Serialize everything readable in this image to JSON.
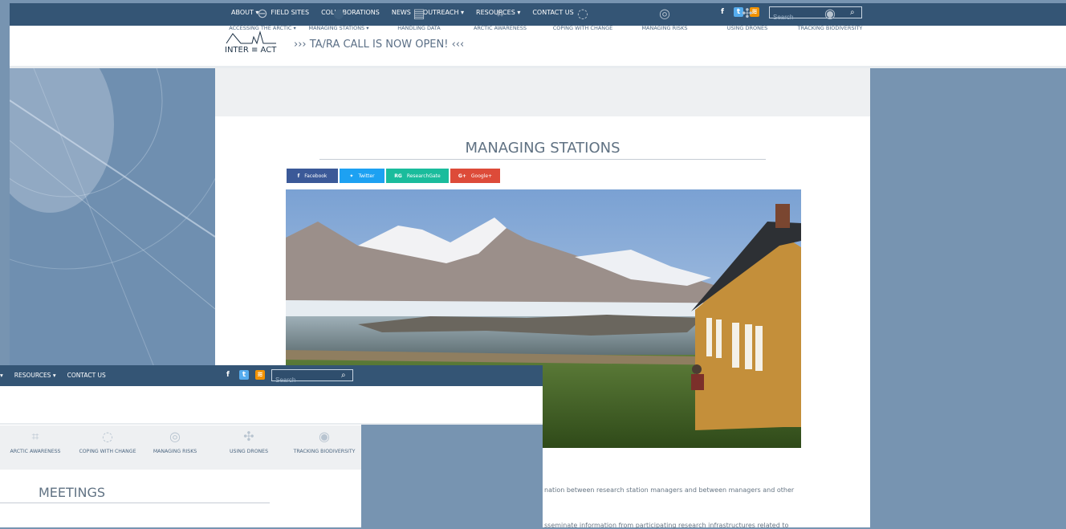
{
  "nav": {
    "items": [
      "ABOUT ▾",
      "FIELD SITES",
      "COLLABORATIONS",
      "NEWS",
      "OUTREACH ▾",
      "RESOURCES ▾",
      "CONTACT US"
    ],
    "search_placeholder": "Search"
  },
  "header": {
    "logo_text": "INTER ≡ ACT",
    "announcement": "››› TA/RA CALL IS NOW OPEN! ‹‹‹"
  },
  "icons_bar": [
    {
      "label": "ACCESSING THE ARCTIC ▾",
      "icon": "plug-icon"
    },
    {
      "label": "MANAGING STATIONS ▾",
      "icon": "chat-icon"
    },
    {
      "label": "HANDLING DATA",
      "icon": "database-icon"
    },
    {
      "label": "ARCTIC AWARENESS",
      "icon": "network-icon"
    },
    {
      "label": "COPING WITH CHANGE",
      "icon": "loop-icon"
    },
    {
      "label": "MANAGING RISKS",
      "icon": "shield-icon"
    },
    {
      "label": "USING DRONES",
      "icon": "drone-icon"
    },
    {
      "label": "TRACKING BIODIVERSITY",
      "icon": "target-icon"
    }
  ],
  "main": {
    "title": "MANAGING STATIONS",
    "share": [
      "Facebook",
      "Twitter",
      "ResearchGate",
      "Google+"
    ],
    "para1": "nation between research station managers and between managers and other",
    "para2": "sseminate information from participating research infrastructures related to"
  },
  "overlay": {
    "nav": [
      "▾",
      "RESOURCES ▾",
      "CONTACT US"
    ],
    "search_placeholder": "Search",
    "icons": [
      {
        "label": "ARCTIC AWARENESS"
      },
      {
        "label": "COPING WITH CHANGE"
      },
      {
        "label": "MANAGING RISKS"
      },
      {
        "label": "USING DRONES"
      },
      {
        "label": "TRACKING BIODIVERSITY"
      }
    ],
    "title": "MEETINGS"
  },
  "colors": {
    "nav_bg": "#345575",
    "page_bg": "#7794b1",
    "facebook": "#3b5998",
    "twitter": "#1da1f2",
    "researchgate": "#1abc9c",
    "googleplus": "#dd4b39"
  }
}
